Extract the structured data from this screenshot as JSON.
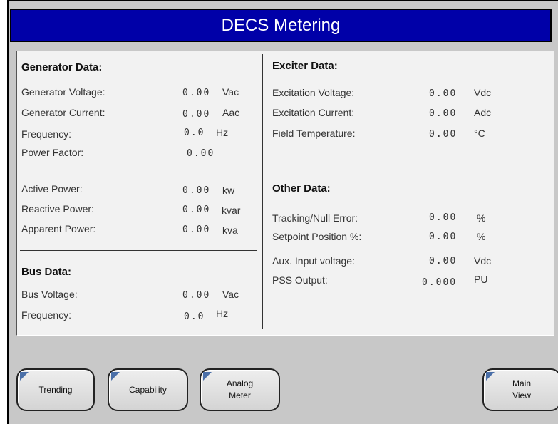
{
  "title": "DECS Metering",
  "generator": {
    "header": "Generator Data:",
    "rows": [
      {
        "label": "Generator Voltage:",
        "value": "0.00",
        "unit": "Vac"
      },
      {
        "label": "Generator Current:",
        "value": "0.00",
        "unit": "Aac"
      },
      {
        "label": "Frequency:",
        "value": "0.0",
        "unit": "Hz"
      },
      {
        "label": "Power Factor:",
        "value": "0.00",
        "unit": ""
      },
      {
        "label": "Active Power:",
        "value": "0.00",
        "unit": "kw"
      },
      {
        "label": "Reactive Power:",
        "value": "0.00",
        "unit": "kvar"
      },
      {
        "label": "Apparent Power:",
        "value": "0.00",
        "unit": "kva"
      }
    ]
  },
  "bus": {
    "header": "Bus Data:",
    "rows": [
      {
        "label": "Bus Voltage:",
        "value": "0.00",
        "unit": "Vac"
      },
      {
        "label": "Frequency:",
        "value": "0.0",
        "unit": "Hz"
      }
    ]
  },
  "exciter": {
    "header": "Exciter Data:",
    "rows": [
      {
        "label": "Excitation Voltage:",
        "value": "0.00",
        "unit": "Vdc"
      },
      {
        "label": "Excitation Current:",
        "value": "0.00",
        "unit": "Adc"
      },
      {
        "label": "Field Temperature:",
        "value": "0.00",
        "unit": "°C"
      }
    ]
  },
  "other": {
    "header": "Other Data:",
    "rows": [
      {
        "label": "Tracking/Null Error:",
        "value": "0.00",
        "unit": "%"
      },
      {
        "label": "Setpoint Position %:",
        "value": "0.00",
        "unit": "%"
      },
      {
        "label": "Aux. Input voltage:",
        "value": "0.00",
        "unit": "Vdc"
      },
      {
        "label": "PSS Output:",
        "value": "0.000",
        "unit": "PU"
      }
    ]
  },
  "buttons": {
    "trending": "Trending",
    "capability": "Capability",
    "analog_meter": "Analog\nMeter",
    "main_view": "Main\nView"
  },
  "colors": {
    "title_bg": "#0000a8",
    "frame_bg": "#c8c8c8",
    "panel_bg": "#f2f2f2",
    "corner_icon": "#4a6fa8"
  }
}
